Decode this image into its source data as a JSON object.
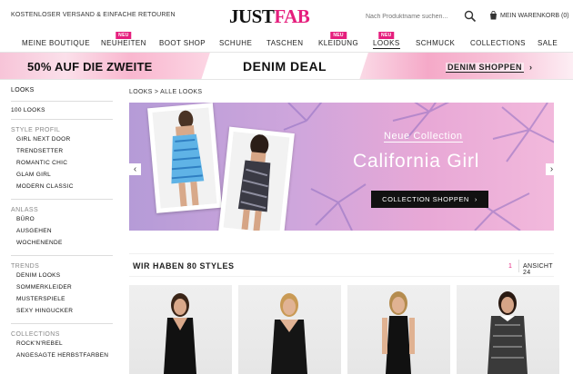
{
  "topbar": {
    "shipping": "KOSTENLOSER VERSAND & EINFACHE RETOUREN",
    "logo_just": "JUST",
    "logo_fab": "FAB",
    "search_placeholder": "Nach Produktname suchen...",
    "cart": "MEIN WARENKORB (0)"
  },
  "nav": {
    "items": [
      {
        "label": "MEINE BOUTIQUE"
      },
      {
        "label": "NEUHEITEN",
        "badge": "NEU"
      },
      {
        "label": "BOOT SHOP"
      },
      {
        "label": "SCHUHE"
      },
      {
        "label": "TASCHEN"
      },
      {
        "label": "KLEIDUNG",
        "badge": "NEU"
      },
      {
        "label": "LOOKS",
        "badge": "NEU",
        "active": true
      },
      {
        "label": "SCHMUCK"
      },
      {
        "label": "COLLECTIONS"
      },
      {
        "label": "SALE"
      }
    ]
  },
  "promo": {
    "left": "50% AUF DIE ZWEITE",
    "middle": "DENIM DEAL",
    "cta": "DENIM SHOPPEN",
    "cta_chevron": "›"
  },
  "sidebar": {
    "heading": "LOOKS",
    "top_item": "100 LOOKS",
    "sections": [
      {
        "title": "STYLE PROFIL",
        "items": [
          "GIRL NEXT DOOR",
          "TRENDSETTER",
          "ROMANTIC CHIC",
          "GLAM GIRL",
          "MODERN CLASSIC"
        ]
      },
      {
        "title": "ANLASS",
        "items": [
          "BÜRO",
          "AUSGEHEN",
          "WOCHENENDE"
        ]
      },
      {
        "title": "TRENDS",
        "items": [
          "DENIM LOOKS",
          "SOMMERKLEIDER",
          "MUSTERSPIELE",
          "SEXY HINGUCKER"
        ]
      },
      {
        "title": "COLLECTIONS",
        "items": [
          "ROCK'N'REBEL",
          "ANGESAGTE HERBSTFARBEN"
        ]
      }
    ]
  },
  "breadcrumb": "LOOKS  >  ALLE LOOKS",
  "hero": {
    "eyebrow": "Neue Collection",
    "title": "California Girl",
    "cta": "COLLECTION SHOPPEN",
    "cta_chevron": "›",
    "prev": "‹",
    "next": "›"
  },
  "styles": {
    "count": "WIR HABEN 80 STYLES",
    "page": "1",
    "view": "ANSICHT 24"
  },
  "colors": {
    "accent": "#e51e7d",
    "dark": "#111111"
  },
  "icons": {
    "search": "search-icon",
    "cart": "cart-icon"
  }
}
